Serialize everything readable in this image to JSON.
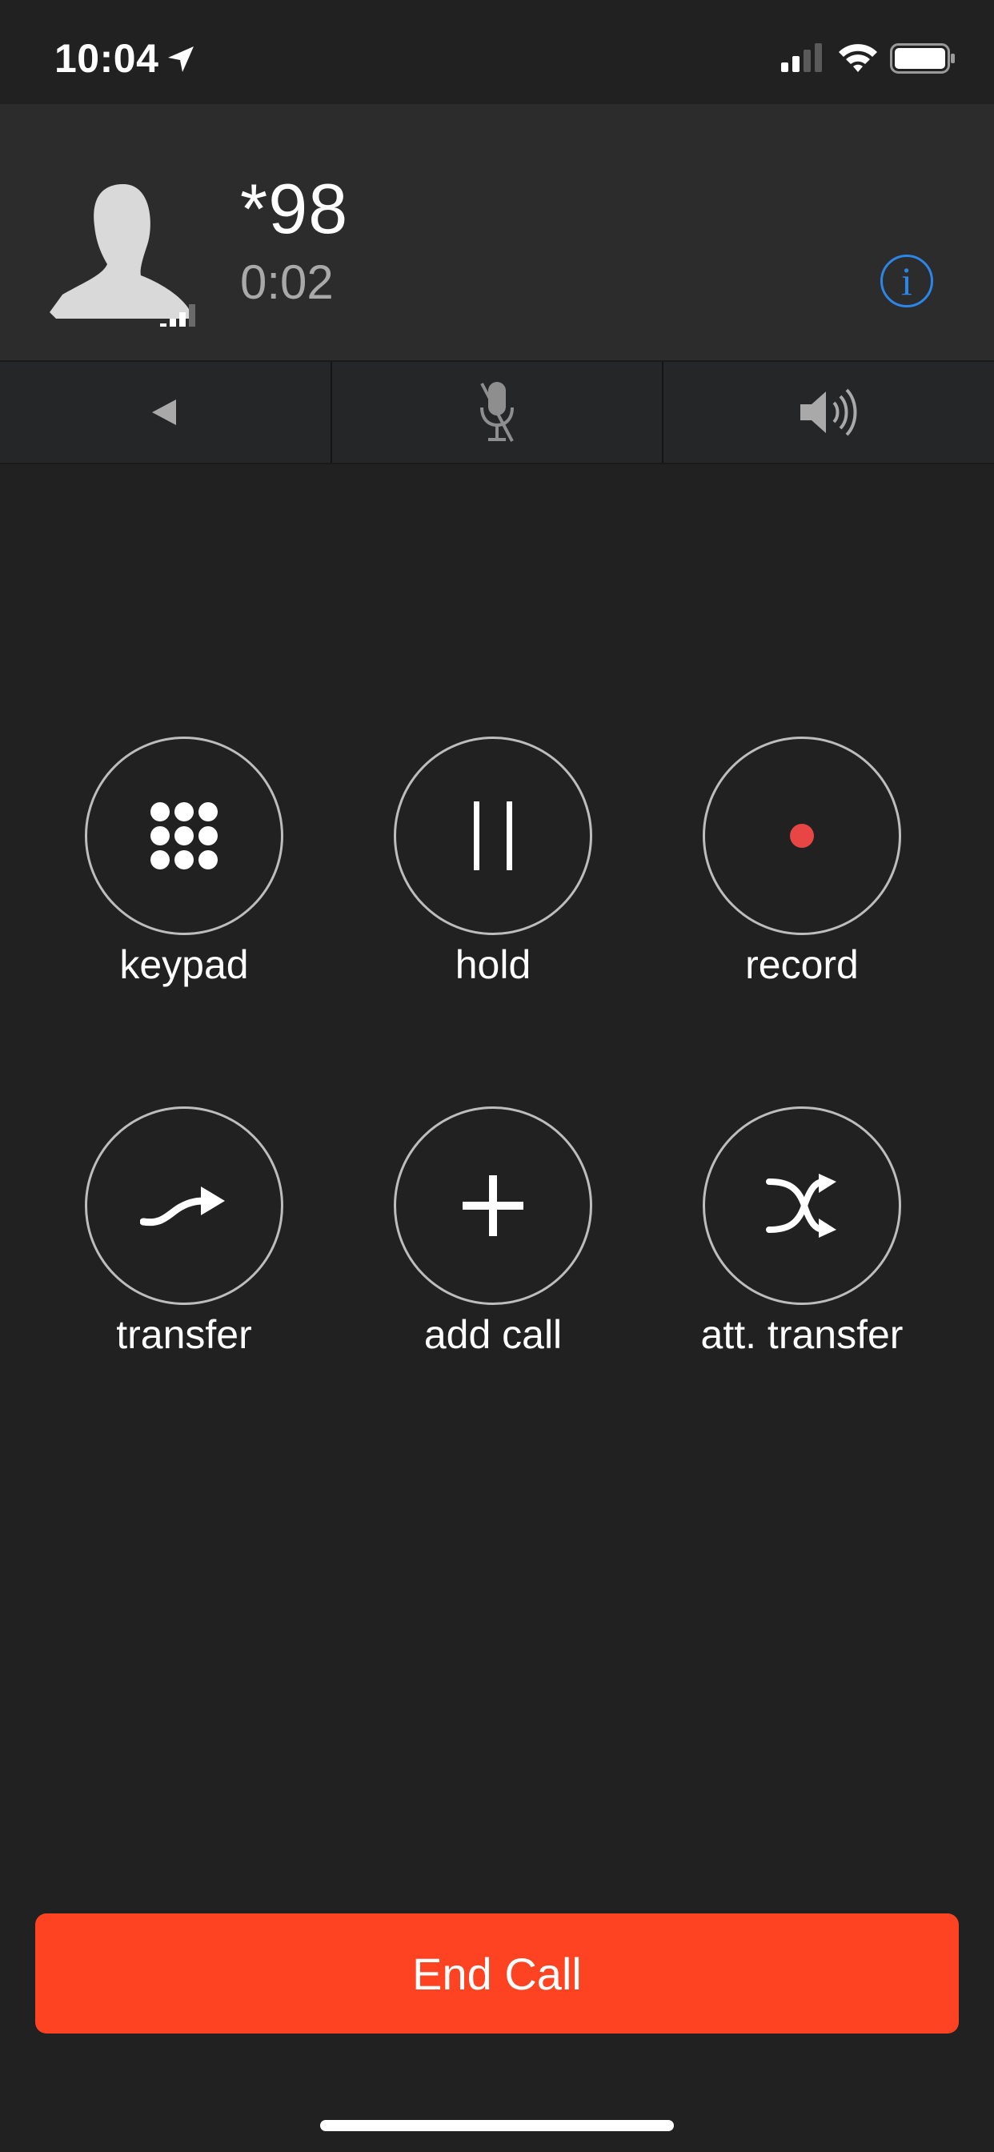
{
  "status_bar": {
    "time": "10:04",
    "icons": [
      "location-arrow-icon",
      "cellular-signal-icon",
      "wifi-icon",
      "battery-icon"
    ]
  },
  "call": {
    "caller_number": "*98",
    "duration": "0:02"
  },
  "controls": [
    {
      "name": "back",
      "icon": "back-arrow-icon"
    },
    {
      "name": "mute",
      "icon": "microphone-muted-icon"
    },
    {
      "name": "speaker",
      "icon": "speaker-icon"
    }
  ],
  "actions": {
    "keypad": "keypad",
    "hold": "hold",
    "record": "record",
    "transfer": "transfer",
    "add_call": "add call",
    "att_transfer": "att. transfer"
  },
  "end_call_label": "End Call",
  "colors": {
    "background": "#212121",
    "header": "#2c2c2c",
    "end_call": "#fe4322",
    "info_accent": "#2b86e8",
    "record_dot": "#e84545"
  }
}
